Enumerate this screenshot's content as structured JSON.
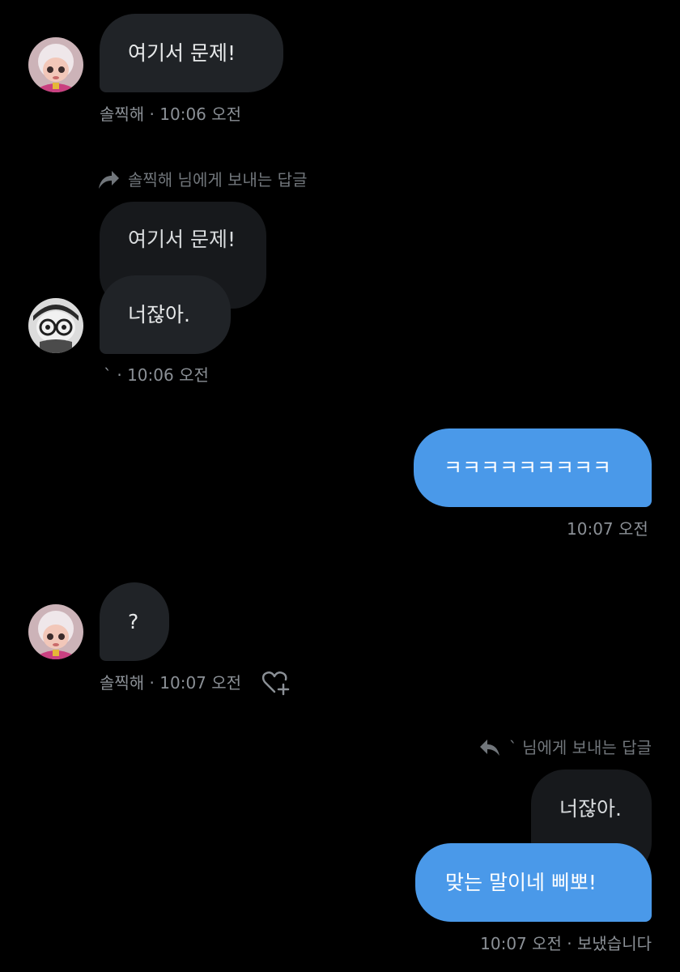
{
  "messages": [
    {
      "text": "여기서 문제!",
      "meta": "솔찍해 · 10:06 오전"
    },
    {
      "reply_label": "솔찍해 님에게 보내는 답글",
      "quoted": "여기서 문제!",
      "text": "너잖아.",
      "meta": "` · 10:06 오전"
    },
    {
      "text": "ㅋㅋㅋㅋㅋㅋㅋㅋㅋ",
      "meta": "10:07 오전"
    },
    {
      "text": "?",
      "meta": "솔찍해 · 10:07 오전"
    },
    {
      "reply_label": "` 님에게 보내는 답글",
      "quoted": "너잖아.",
      "text": "맞는 말이네 삐뽀!",
      "meta": "10:07 오전 · 보냈습니다"
    }
  ],
  "icons": {
    "reply_forward": "reply-arrow-icon",
    "reply_back": "reply-back-icon",
    "reaction": "add-reaction-heart-icon"
  },
  "colors": {
    "background": "#000000",
    "incoming_bubble": "#202327",
    "outgoing_bubble": "#4a99e9",
    "quoted_bubble": "#17191c",
    "meta_text": "#8b9096"
  }
}
